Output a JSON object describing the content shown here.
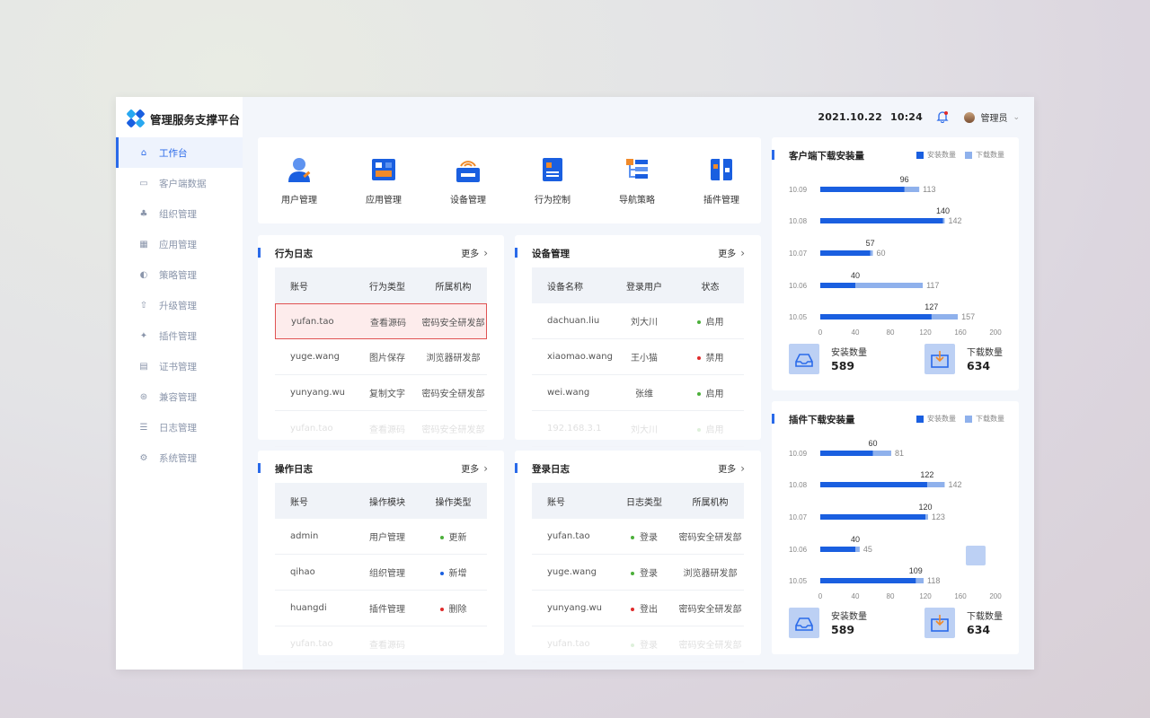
{
  "app": {
    "title": "管理服务支撑平台"
  },
  "header": {
    "date": "2021.10.22",
    "time": "10:24",
    "user": "管理员"
  },
  "sidebar": {
    "items": [
      {
        "label": "工作台",
        "icon": "home-icon",
        "active": true
      },
      {
        "label": "客户端数据",
        "icon": "monitor-icon"
      },
      {
        "label": "组织管理",
        "icon": "org-icon"
      },
      {
        "label": "应用管理",
        "icon": "apps-icon"
      },
      {
        "label": "策略管理",
        "icon": "strategy-icon"
      },
      {
        "label": "升级管理",
        "icon": "upgrade-icon"
      },
      {
        "label": "插件管理",
        "icon": "plugin-icon"
      },
      {
        "label": "证书管理",
        "icon": "certificate-icon"
      },
      {
        "label": "兼容管理",
        "icon": "compat-icon"
      },
      {
        "label": "日志管理",
        "icon": "log-icon"
      },
      {
        "label": "系统管理",
        "icon": "settings-icon"
      }
    ]
  },
  "quick": {
    "items": [
      {
        "label": "用户管理",
        "icon": "user-manage-icon"
      },
      {
        "label": "应用管理",
        "icon": "app-manage-icon"
      },
      {
        "label": "设备管理",
        "icon": "device-manage-icon"
      },
      {
        "label": "行为控制",
        "icon": "behavior-control-icon"
      },
      {
        "label": "导航策略",
        "icon": "navigation-policy-icon"
      },
      {
        "label": "插件管理",
        "icon": "plugin-manage-icon"
      }
    ]
  },
  "more_label": "更多",
  "behavior_log": {
    "title": "行为日志",
    "headers": [
      "账号",
      "行为类型",
      "所属机构"
    ],
    "rows": [
      [
        "yufan.tao",
        "查看源码",
        "密码安全研发部"
      ],
      [
        "yuge.wang",
        "图片保存",
        "浏览器研发部"
      ],
      [
        "yunyang.wu",
        "复制文字",
        "密码安全研发部"
      ],
      [
        "yufan.tao",
        "查看源码",
        "密码安全研发部"
      ]
    ]
  },
  "device_mgmt": {
    "title": "设备管理",
    "headers": [
      "设备名称",
      "登录用户",
      "状态"
    ],
    "rows": [
      [
        "dachuan.liu",
        "刘大川",
        "启用",
        "green"
      ],
      [
        "xiaomao.wang",
        "王小猫",
        "禁用",
        "red"
      ],
      [
        "wei.wang",
        "张维",
        "启用",
        "green"
      ],
      [
        "192.168.3.1",
        "刘大川",
        "启用",
        "green"
      ]
    ]
  },
  "operation_log": {
    "title": "操作日志",
    "headers": [
      "账号",
      "操作模块",
      "操作类型"
    ],
    "rows": [
      [
        "admin",
        "用户管理",
        "更新",
        "green"
      ],
      [
        "qihao",
        "组织管理",
        "新增",
        "blue"
      ],
      [
        "huangdi",
        "插件管理",
        "删除",
        "red"
      ],
      [
        "yufan.tao",
        "查看源码",
        "",
        ""
      ]
    ]
  },
  "login_log": {
    "title": "登录日志",
    "headers": [
      "账号",
      "日志类型",
      "所属机构"
    ],
    "rows": [
      [
        "yufan.tao",
        "登录",
        "密码安全研发部",
        "green"
      ],
      [
        "yuge.wang",
        "登录",
        "浏览器研发部",
        "green"
      ],
      [
        "yunyang.wu",
        "登出",
        "密码安全研发部",
        "red"
      ],
      [
        "yufan.tao",
        "登录",
        "密码安全研发部",
        "green"
      ]
    ]
  },
  "colors": {
    "accent": "#2a6ae9",
    "install_bar": "#1a5fe0",
    "download_bar": "#8fb1ec",
    "green": "#4caf3b",
    "red": "#e02b2b",
    "blue": "#1a5fe0"
  },
  "chart_data": [
    {
      "type": "bar",
      "title": "客户端下载安装量",
      "orientation": "horizontal",
      "categories": [
        "10.09",
        "10.08",
        "10.07",
        "10.06",
        "10.05"
      ],
      "series": [
        {
          "name": "安装数量",
          "values": [
            96,
            140,
            57,
            40,
            127
          ]
        },
        {
          "name": "下载数量",
          "values": [
            113,
            142,
            60,
            117,
            157
          ]
        }
      ],
      "xlim": [
        0,
        200
      ],
      "xticks": [
        0,
        40,
        80,
        120,
        160,
        200
      ],
      "totals": {
        "install_label": "安装数量",
        "install": "589",
        "download_label": "下载数量",
        "download": "634"
      }
    },
    {
      "type": "bar",
      "title": "插件下载安装量",
      "orientation": "horizontal",
      "categories": [
        "10.09",
        "10.08",
        "10.07",
        "10.06",
        "10.05"
      ],
      "series": [
        {
          "name": "安装数量",
          "values": [
            60,
            122,
            120,
            40,
            109
          ]
        },
        {
          "name": "下载数量",
          "values": [
            81,
            142,
            123,
            45,
            118
          ]
        }
      ],
      "xlim": [
        0,
        200
      ],
      "xticks": [
        0,
        40,
        80,
        120,
        160,
        200
      ],
      "totals": {
        "install_label": "安装数量",
        "install": "589",
        "download_label": "下载数量",
        "download": "634"
      }
    }
  ]
}
